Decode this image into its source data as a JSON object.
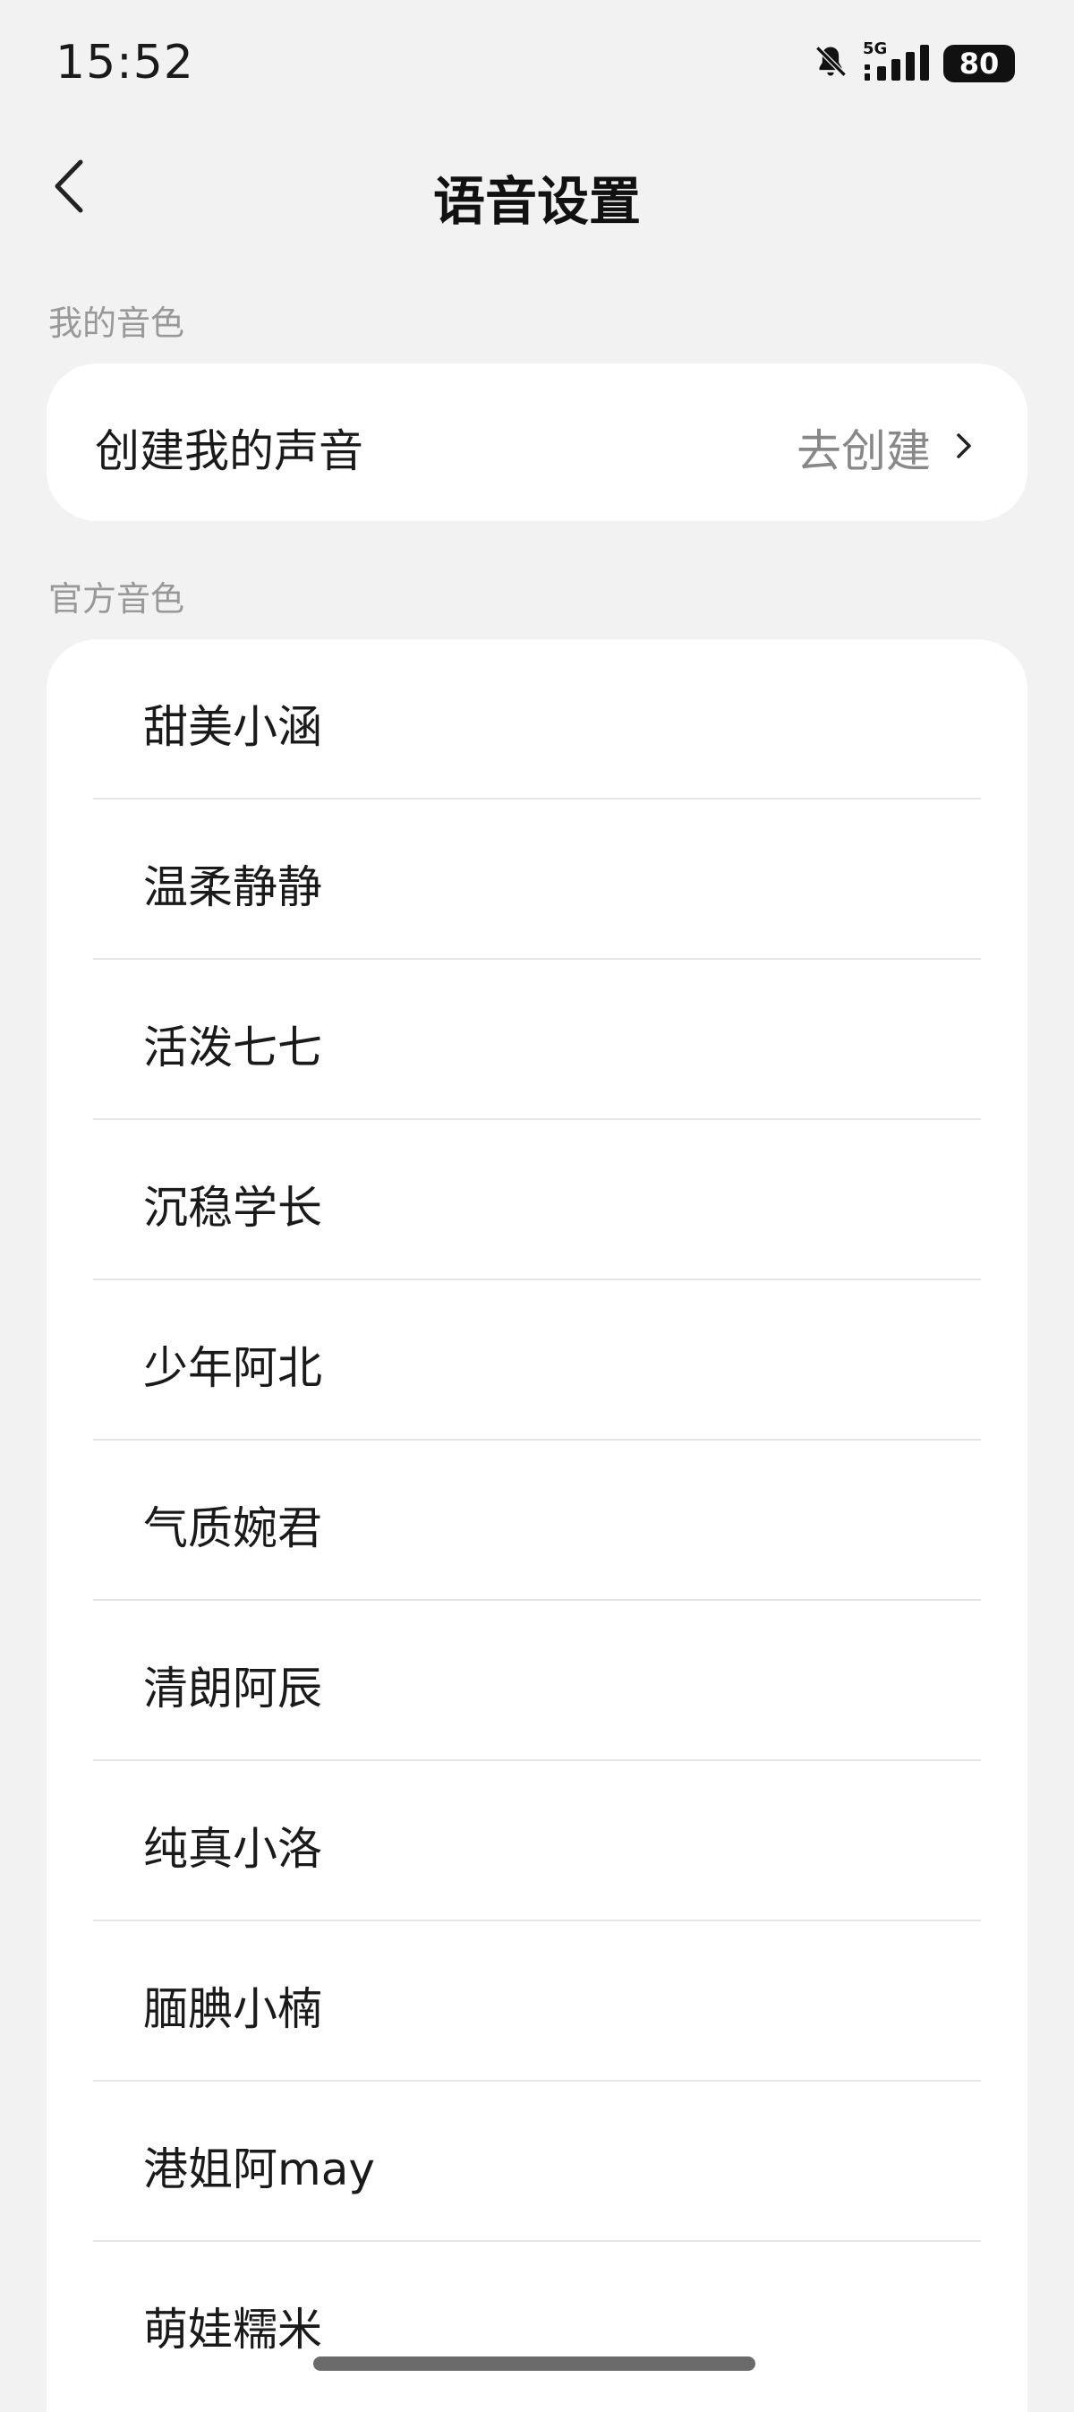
{
  "status": {
    "time": "15:52",
    "network": "5G",
    "battery": "80"
  },
  "header": {
    "title": "语音设置",
    "back_icon": "chevron-left-icon"
  },
  "my_voice": {
    "section_label": "我的音色",
    "create_label": "创建我的声音",
    "create_action": "去创建",
    "action_icon": "chevron-right-icon"
  },
  "official_voices": {
    "section_label": "官方音色",
    "items": [
      {
        "label": "甜美小涵"
      },
      {
        "label": "温柔静静"
      },
      {
        "label": "活泼七七"
      },
      {
        "label": "沉稳学长"
      },
      {
        "label": "少年阿北"
      },
      {
        "label": "气质婉君"
      },
      {
        "label": "清朗阿辰"
      },
      {
        "label": "纯真小洛"
      },
      {
        "label": "腼腆小楠"
      },
      {
        "label": "港姐阿may"
      },
      {
        "label": "萌娃糯米"
      }
    ]
  },
  "colors": {
    "background": "#f2f2f2",
    "card": "#ffffff",
    "secondary_text": "#999999",
    "divider": "#e6e6e6"
  }
}
